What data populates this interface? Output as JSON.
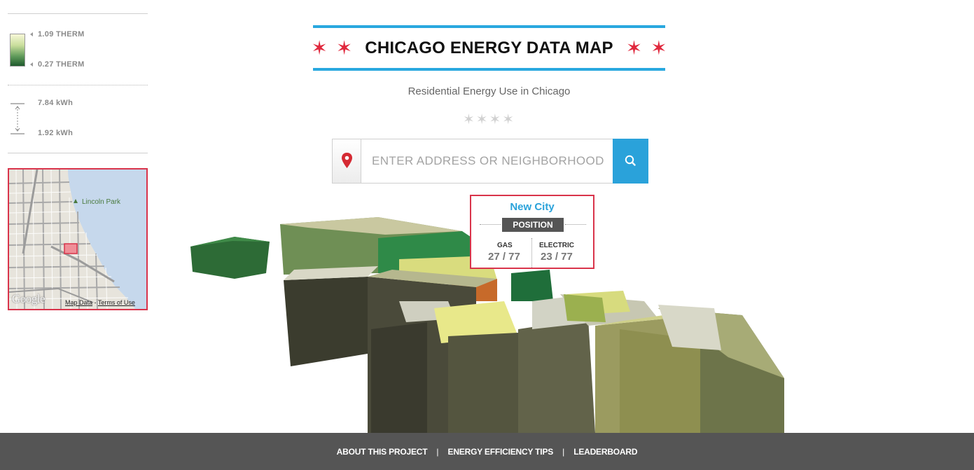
{
  "legend": {
    "gas_high": "1.09 THERM",
    "gas_low": "0.27 THERM",
    "elec_high": "7.84 kWh",
    "elec_low": "1.92 kWh"
  },
  "minimap": {
    "place_label": "Lincoln Park",
    "logo": "Google",
    "map_data_link": "Map Data",
    "separator": "-",
    "terms_link": "Terms of Use"
  },
  "header": {
    "title": "CHICAGO ENERGY DATA MAP",
    "subtitle": "Residential Energy Use in Chicago",
    "decor_stars": "✶✶✶✶"
  },
  "search": {
    "placeholder": "ENTER ADDRESS OR NEIGHBORHOOD",
    "pin_icon": "map-pin-icon",
    "search_icon": "magnifier-icon"
  },
  "info": {
    "neighborhood": "New City",
    "position_label": "POSITION",
    "gas_label": "GAS",
    "gas_rank": "27 / 77",
    "electric_label": "ELECTRIC",
    "electric_rank": "23 / 77"
  },
  "footer": {
    "links": [
      "ABOUT THIS PROJECT",
      "ENERGY EFFICIENCY TIPS",
      "LEADERBOARD"
    ],
    "separator": "|"
  },
  "colors": {
    "accent_blue": "#2aa2da",
    "accent_red": "#e0283d",
    "footer_bg": "#555555"
  }
}
